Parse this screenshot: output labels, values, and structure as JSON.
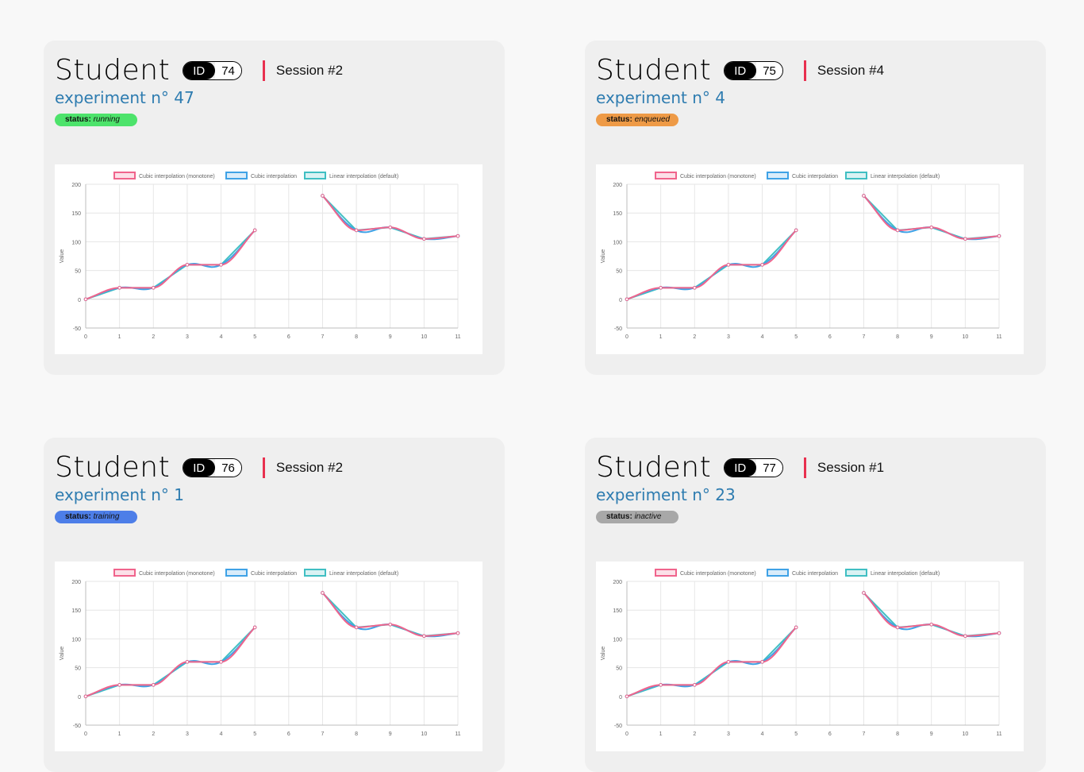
{
  "cards": [
    {
      "title": "Student",
      "id_label": "ID",
      "id_value": "74",
      "session": "Session #2",
      "experiment": "experiment n° 47",
      "status_key": "status:",
      "status_value": "running",
      "status_color": "#4de36b"
    },
    {
      "title": "Student",
      "id_label": "ID",
      "id_value": "75",
      "session": "Session #4",
      "experiment": "experiment n° 4",
      "status_key": "status:",
      "status_value": "enqueued",
      "status_color": "#ee9a46"
    },
    {
      "title": "Student",
      "id_label": "ID",
      "id_value": "76",
      "session": "Session #2",
      "experiment": "experiment n° 1",
      "status_key": "status:",
      "status_value": "training",
      "status_color": "#4d7ee8"
    },
    {
      "title": "Student",
      "id_label": "ID",
      "id_value": "77",
      "session": "Session #1",
      "experiment": "experiment n° 23",
      "status_key": "status:",
      "status_value": "inactive",
      "status_color": "#a8a8a8"
    }
  ],
  "chart_data": {
    "type": "line",
    "ylabel": "Value",
    "xlabel": "",
    "ylim": [
      -50,
      200
    ],
    "yticks": [
      -50,
      0,
      50,
      100,
      150,
      200
    ],
    "x": [
      0,
      1,
      2,
      3,
      4,
      5,
      6,
      7,
      8,
      9,
      10,
      11
    ],
    "grid": true,
    "legend": "top",
    "series": [
      {
        "name": "Cubic interpolation (monotone)",
        "values": [
          0,
          20,
          20,
          60,
          60,
          120,
          null,
          180,
          120,
          125,
          105,
          110
        ],
        "color": "#f0648c"
      },
      {
        "name": "Cubic interpolation",
        "values": [
          0,
          20,
          20,
          60,
          60,
          120,
          null,
          180,
          120,
          125,
          105,
          110
        ],
        "color": "#3fa2e6"
      },
      {
        "name": "Linear interpolation (default)",
        "values": [
          0,
          20,
          20,
          60,
          60,
          120,
          null,
          180,
          120,
          125,
          105,
          110
        ],
        "color": "#40bfc3"
      }
    ]
  }
}
